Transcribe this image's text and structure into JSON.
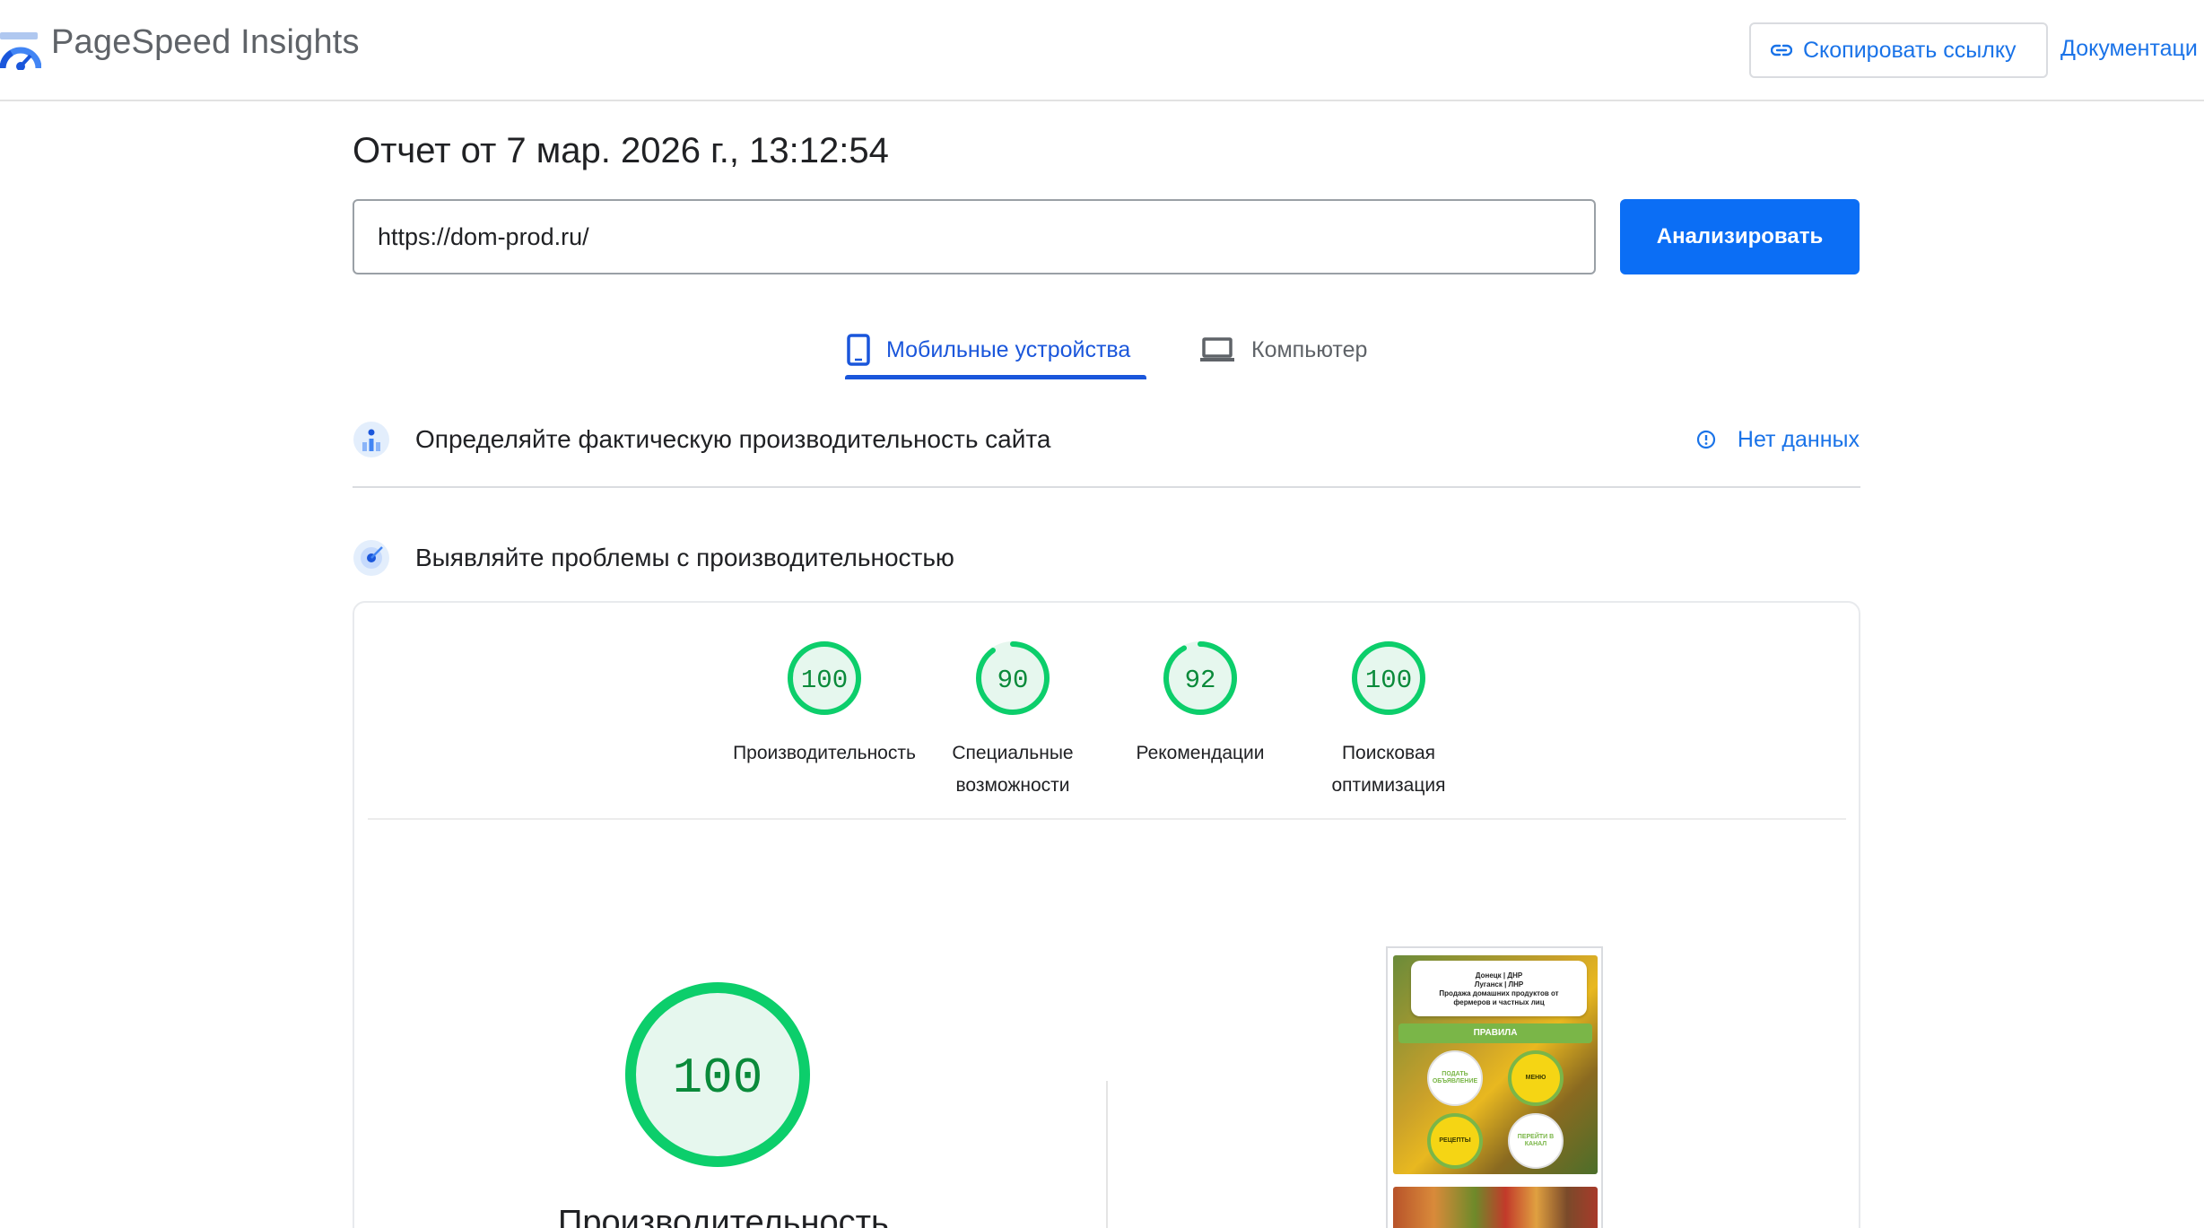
{
  "header": {
    "app_title": "PageSpeed Insights",
    "copy_link_label": "Скопировать ссылку",
    "docs_label": "Документаци"
  },
  "report": {
    "title": "Отчет от 7 мар. 2026 г., 13:12:54",
    "url_value": "https://dom-prod.ru/",
    "analyze_label": "Анализировать"
  },
  "tabs": [
    {
      "label": "Мобильные устройства",
      "icon": "smartphone-icon",
      "active": true
    },
    {
      "label": "Компьютер",
      "icon": "laptop-icon",
      "active": false
    }
  ],
  "field_data": {
    "title": "Определяйте фактическую производительность сайта",
    "status_label": "Нет данных"
  },
  "lab_data": {
    "title": "Выявляйте проблемы с производительностью"
  },
  "scores": [
    {
      "value": 100,
      "label": "Производительность"
    },
    {
      "value": 90,
      "label": "Специальные возможности"
    },
    {
      "value": 92,
      "label": "Рекомендации"
    },
    {
      "value": 100,
      "label": "Поисковая оптимизация"
    }
  ],
  "main_score": {
    "value": 100,
    "label": "Производительность"
  },
  "preview": {
    "card_lines": [
      "Донецк | ДНР",
      "Луганск | ЛНР",
      "Продажа домашних продуктов от",
      "фермеров и частных лиц"
    ],
    "rules_label": "ПРАВИЛА",
    "buttons": [
      "ПОДАТЬ ОБЪЯВЛЕНИЕ",
      "МЕНЮ",
      "РЕЦЕПТЫ",
      "ПЕРЕЙТИ В КАНАЛ"
    ]
  },
  "colors": {
    "pass_green": "#0cce6b",
    "pass_fill": "#e6f7ee",
    "score_text": "#0a8a3a",
    "accent_blue": "#1a73e8",
    "button_blue": "#0b6ef5"
  }
}
